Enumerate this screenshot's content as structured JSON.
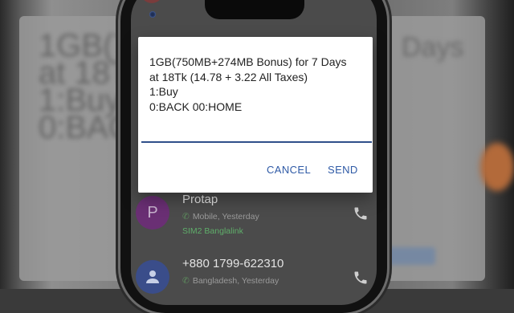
{
  "dialog": {
    "message": "1GB(750MB+274MB Bonus) for 7 Days\nat 18Tk (14.78 + 3.22 All Taxes)\n1:Buy\n0:BACK 00:HOME",
    "input_value": "",
    "cancel_label": "CANCEL",
    "send_label": "SEND"
  },
  "contacts": [
    {
      "initial": "P",
      "name": "Protap",
      "meta": "Mobile, Yesterday",
      "sim": "SIM2 Banglalink",
      "avatar_color": "#6a2f74"
    },
    {
      "initial": "",
      "name": "+880 1799-622310",
      "meta": "Bangladesh, Yesterday",
      "sim": "",
      "avatar_color": "#3a4d8a"
    }
  ],
  "background": {
    "blurred_text": "1GB(7\nat 18T\n1:Buy\n0:BACK",
    "blurred_text_right": "Days"
  },
  "colors": {
    "accent": "#2f5aa6",
    "input_underline": "#2f4f8a",
    "sim_green": "#5fae6a",
    "dialog_bg": "#ffffff"
  },
  "icons": {
    "call": "phone-icon",
    "mobile": "phone-glyph-icon",
    "avatar_default": "person-icon"
  }
}
